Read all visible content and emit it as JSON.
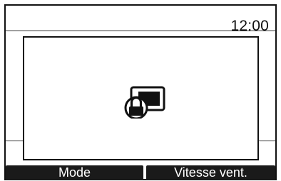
{
  "status_bar": {
    "time": "12:00"
  },
  "popup": {
    "icon": "keypad-lock-icon"
  },
  "softkeys": {
    "mode_label": "Mode",
    "fan_speed_label": "Vitesse vent."
  }
}
